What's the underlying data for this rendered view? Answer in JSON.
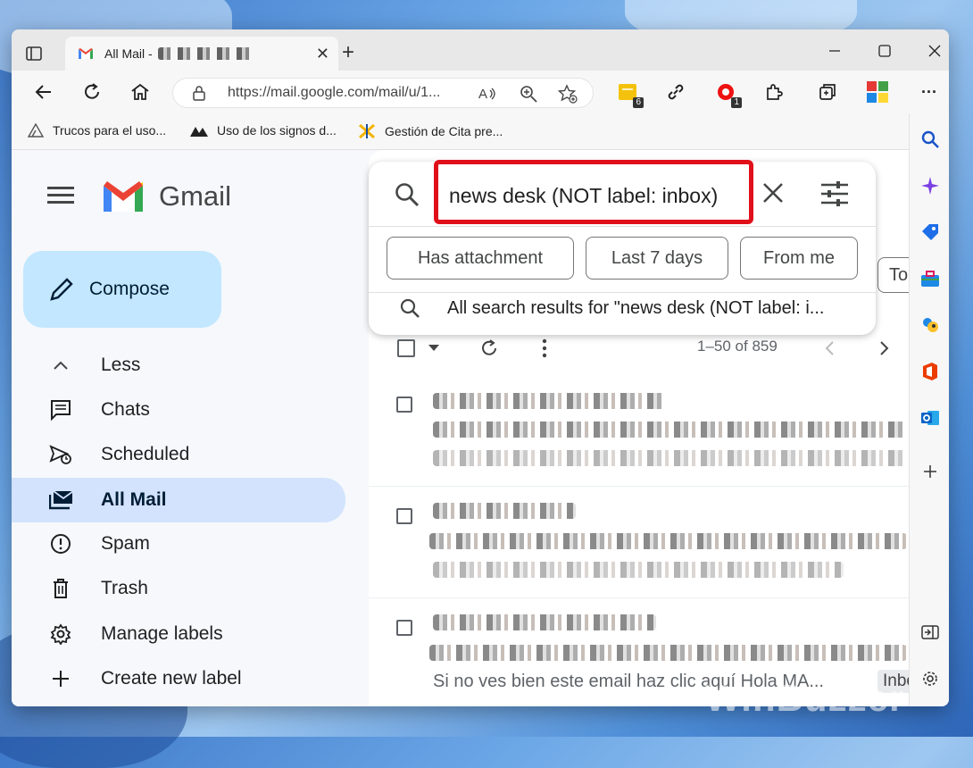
{
  "browser": {
    "tab_title": "All Mail - ",
    "tab_close": "✕",
    "new_tab": "+",
    "url": "https://mail.google.com/mail/u/1...",
    "ext_badge_1": "6",
    "ext_badge_2": "1",
    "more": "···"
  },
  "bookmarks": [
    {
      "label": "Trucos para el uso..."
    },
    {
      "label": "Uso de los signos d..."
    },
    {
      "label": "Gestión de Cita pre..."
    }
  ],
  "gmail": {
    "logo_text": "Gmail",
    "compose": "Compose",
    "nav": [
      {
        "label": "Less",
        "icon": "chevron-up-icon"
      },
      {
        "label": "Chats",
        "icon": "chat-icon"
      },
      {
        "label": "Scheduled",
        "icon": "scheduled-icon"
      },
      {
        "label": "All Mail",
        "icon": "all-mail-icon",
        "active": true
      },
      {
        "label": "Spam",
        "icon": "spam-icon"
      },
      {
        "label": "Trash",
        "icon": "trash-icon"
      },
      {
        "label": "Manage labels",
        "icon": "gear-icon"
      },
      {
        "label": "Create new label",
        "icon": "plus-icon"
      }
    ],
    "search": {
      "query": "news desk (NOT label: inbox)",
      "chips": [
        "Has attachment",
        "Last 7 days",
        "From me"
      ],
      "suggestion": "All search results for \"news desk (NOT label: i..."
    },
    "pager": "1–50 of 859",
    "to_chip": "To",
    "row3_snippet": "Si no ves bien este email haz clic aquí Hola MA...",
    "inbox_chip": "Inbo"
  },
  "watermark": "WinBuzzer",
  "colors": {
    "accent": "#0b57d0",
    "highlight": "#e0101a",
    "compose_bg": "#c2e7ff",
    "active_nav": "#d3e3fd"
  }
}
